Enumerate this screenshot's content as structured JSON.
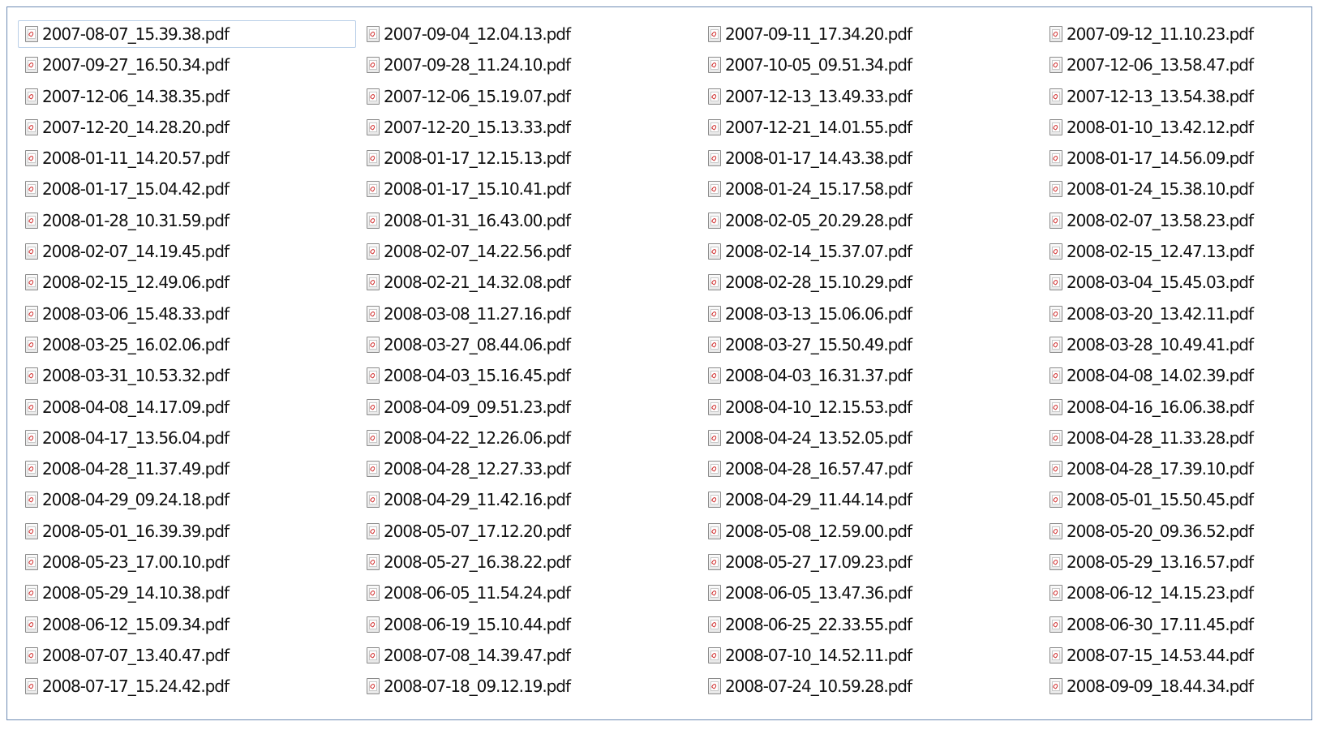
{
  "window": {
    "files": [
      "2007-08-07_15.39.38.pdf",
      "2007-09-04_12.04.13.pdf",
      "2007-09-11_17.34.20.pdf",
      "2007-09-12_11.10.23.pdf",
      "2007-09-27_16.50.34.pdf",
      "2007-09-28_11.24.10.pdf",
      "2007-10-05_09.51.34.pdf",
      "2007-12-06_13.58.47.pdf",
      "2007-12-06_14.38.35.pdf",
      "2007-12-06_15.19.07.pdf",
      "2007-12-13_13.49.33.pdf",
      "2007-12-13_13.54.38.pdf",
      "2007-12-20_14.28.20.pdf",
      "2007-12-20_15.13.33.pdf",
      "2007-12-21_14.01.55.pdf",
      "2008-01-10_13.42.12.pdf",
      "2008-01-11_14.20.57.pdf",
      "2008-01-17_12.15.13.pdf",
      "2008-01-17_14.43.38.pdf",
      "2008-01-17_14.56.09.pdf",
      "2008-01-17_15.04.42.pdf",
      "2008-01-17_15.10.41.pdf",
      "2008-01-24_15.17.58.pdf",
      "2008-01-24_15.38.10.pdf",
      "2008-01-28_10.31.59.pdf",
      "2008-01-31_16.43.00.pdf",
      "2008-02-05_20.29.28.pdf",
      "2008-02-07_13.58.23.pdf",
      "2008-02-07_14.19.45.pdf",
      "2008-02-07_14.22.56.pdf",
      "2008-02-14_15.37.07.pdf",
      "2008-02-15_12.47.13.pdf",
      "2008-02-15_12.49.06.pdf",
      "2008-02-21_14.32.08.pdf",
      "2008-02-28_15.10.29.pdf",
      "2008-03-04_15.45.03.pdf",
      "2008-03-06_15.48.33.pdf",
      "2008-03-08_11.27.16.pdf",
      "2008-03-13_15.06.06.pdf",
      "2008-03-20_13.42.11.pdf",
      "2008-03-25_16.02.06.pdf",
      "2008-03-27_08.44.06.pdf",
      "2008-03-27_15.50.49.pdf",
      "2008-03-28_10.49.41.pdf",
      "2008-03-31_10.53.32.pdf",
      "2008-04-03_15.16.45.pdf",
      "2008-04-03_16.31.37.pdf",
      "2008-04-08_14.02.39.pdf",
      "2008-04-08_14.17.09.pdf",
      "2008-04-09_09.51.23.pdf",
      "2008-04-10_12.15.53.pdf",
      "2008-04-16_16.06.38.pdf",
      "2008-04-17_13.56.04.pdf",
      "2008-04-22_12.26.06.pdf",
      "2008-04-24_13.52.05.pdf",
      "2008-04-28_11.33.28.pdf",
      "2008-04-28_11.37.49.pdf",
      "2008-04-28_12.27.33.pdf",
      "2008-04-28_16.57.47.pdf",
      "2008-04-28_17.39.10.pdf",
      "2008-04-29_09.24.18.pdf",
      "2008-04-29_11.42.16.pdf",
      "2008-04-29_11.44.14.pdf",
      "2008-05-01_15.50.45.pdf",
      "2008-05-01_16.39.39.pdf",
      "2008-05-07_17.12.20.pdf",
      "2008-05-08_12.59.00.pdf",
      "2008-05-20_09.36.52.pdf",
      "2008-05-23_17.00.10.pdf",
      "2008-05-27_16.38.22.pdf",
      "2008-05-27_17.09.23.pdf",
      "2008-05-29_13.16.57.pdf",
      "2008-05-29_14.10.38.pdf",
      "2008-06-05_11.54.24.pdf",
      "2008-06-05_13.47.36.pdf",
      "2008-06-12_14.15.23.pdf",
      "2008-06-12_15.09.34.pdf",
      "2008-06-19_15.10.44.pdf",
      "2008-06-25_22.33.55.pdf",
      "2008-06-30_17.11.45.pdf",
      "2008-07-07_13.40.47.pdf",
      "2008-07-08_14.39.47.pdf",
      "2008-07-10_14.52.11.pdf",
      "2008-07-15_14.53.44.pdf",
      "2008-07-17_15.24.42.pdf",
      "2008-07-18_09.12.19.pdf",
      "2008-07-24_10.59.28.pdf",
      "2008-09-09_18.44.34.pdf"
    ],
    "file_icon": "pdf-file-icon",
    "selected_border_color": "#b9cfe8",
    "window_border_color": "#6d8bb3"
  }
}
